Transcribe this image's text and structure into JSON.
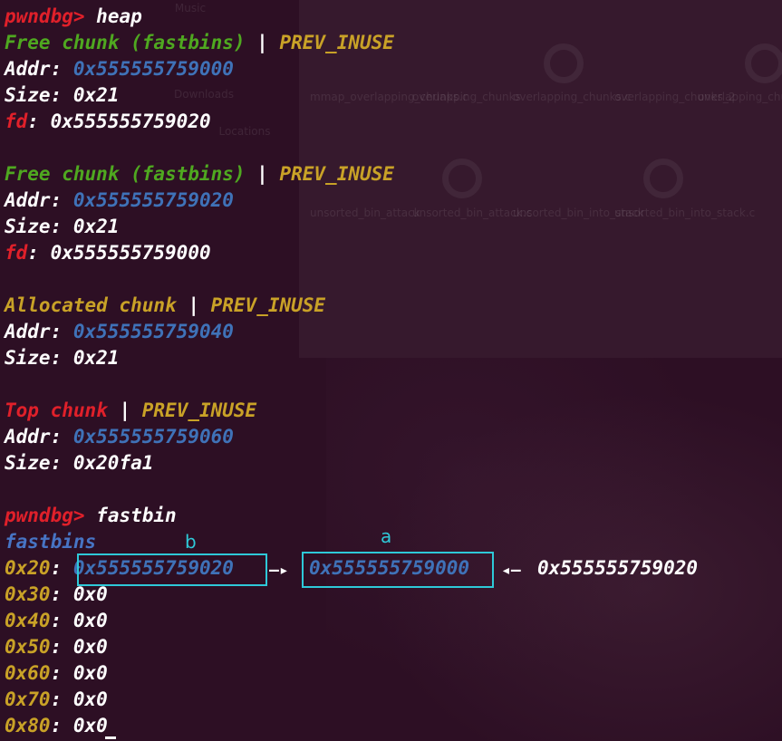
{
  "terminal": {
    "prompt": "pwndbg>",
    "cmd1": "heap",
    "chunks": [
      {
        "type": "Free chunk (fastbins)",
        "sep": "|",
        "flag": "PREV_INUSE",
        "addr_label": "Addr:",
        "addr": "0x555555759000",
        "size_label": "Size:",
        "size": "0x21",
        "fd_label": "fd",
        "fd_sep": ":",
        "fd": "0x555555759020"
      },
      {
        "type": "Free chunk (fastbins)",
        "sep": "|",
        "flag": "PREV_INUSE",
        "addr_label": "Addr:",
        "addr": "0x555555759020",
        "size_label": "Size:",
        "size": "0x21",
        "fd_label": "fd",
        "fd_sep": ":",
        "fd": "0x555555759000"
      },
      {
        "type": "Allocated chunk",
        "sep": "|",
        "flag": "PREV_INUSE",
        "addr_label": "Addr:",
        "addr": "0x555555759040",
        "size_label": "Size:",
        "size": "0x21"
      },
      {
        "type": "Top chunk",
        "sep": "|",
        "flag": "PREV_INUSE",
        "addr_label": "Addr:",
        "addr": "0x555555759060",
        "size_label": "Size:",
        "size": "0x20fa1"
      }
    ],
    "cmd2": "fastbin",
    "fastbins_header": "fastbins",
    "bins": [
      {
        "size": "0x20",
        "sep": ":",
        "head": "0x555555759020",
        "arrow1": "—▸",
        "next": "0x555555759000",
        "arrow2": "◂—",
        "tail": "0x555555759020"
      },
      {
        "size": "0x30",
        "sep": ":",
        "value": "0x0"
      },
      {
        "size": "0x40",
        "sep": ":",
        "value": "0x0"
      },
      {
        "size": "0x50",
        "sep": ":",
        "value": "0x0"
      },
      {
        "size": "0x60",
        "sep": ":",
        "value": "0x0"
      },
      {
        "size": "0x70",
        "sep": ":",
        "value": "0x0"
      },
      {
        "size": "0x80",
        "sep": ":",
        "value": "0x0"
      }
    ]
  },
  "annotations": {
    "b": "b",
    "a": "a"
  },
  "background": {
    "labels": [
      "Music",
      "Downloads",
      "Locations",
      "mmap_overlapping_chunks.c",
      "overlapping_chunks",
      "overlapping_chunks.c",
      "overlapping_chunks_2",
      "overlapping_chunks_2.c",
      "unsorted_bin_attack",
      "unsorted_bin_attack.c",
      "unsorted_bin_into_stack",
      "unsorted_bin_into_stack.c"
    ]
  }
}
